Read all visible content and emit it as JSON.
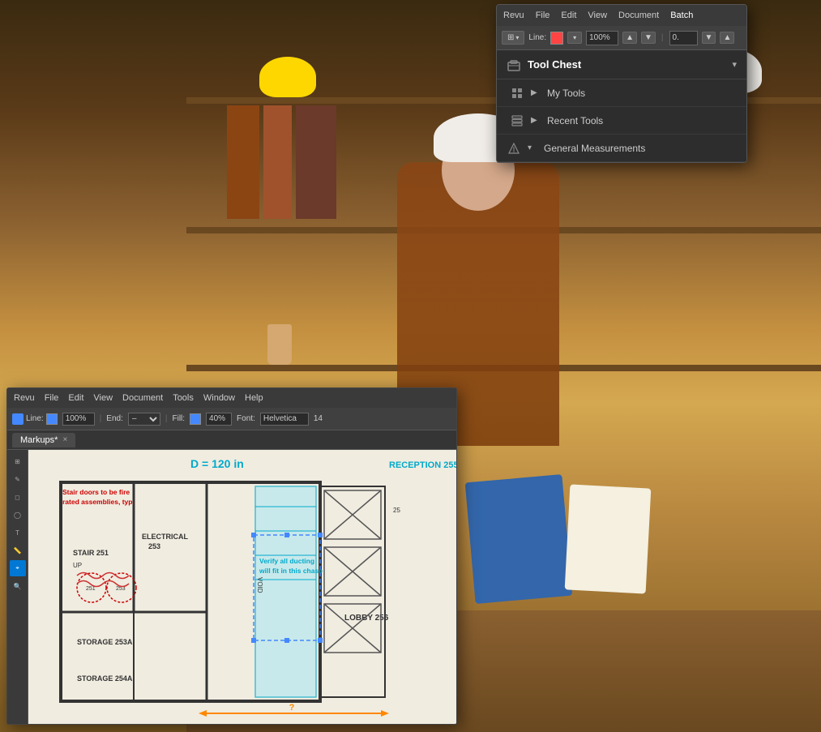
{
  "workshop": {
    "alt": "Worker in hard hat examining blueprints in a workshop"
  },
  "revu_bg": {
    "menubar": {
      "items": [
        "Revu",
        "File",
        "Edit",
        "View",
        "Document",
        "Tools",
        "Window",
        "Help"
      ]
    },
    "toolbar": {
      "line_label": "Line:",
      "zoom_value": "100%",
      "end_label": "End:",
      "fill_label": "Fill:",
      "fill_percent": "40%",
      "font_label": "Font:",
      "font_value": "Helvetica",
      "size_value": "14"
    },
    "tab": {
      "name": "Markups*",
      "close": "×"
    },
    "annotations": {
      "fire_rated": "Stair doors to be fire rated assemblies, typ.",
      "reception": "RECEPTION 255",
      "duct": "Verify all ducting will fit in this chase",
      "dimension_d": "D = 120 in",
      "question": "?"
    },
    "rooms": {
      "stair": "STAIR 251",
      "electrical": "ELECTRICAL 253",
      "storage_a": "STORAGE 253A",
      "storage_b": "STORAGE 254A",
      "lobby": "LOBBY 256",
      "void": "VOID"
    }
  },
  "revu_main": {
    "menubar": {
      "items": [
        "Revu",
        "File",
        "Edit",
        "View",
        "Document",
        "Batch"
      ]
    },
    "toolbar": {
      "line_label": "Line:",
      "zoom_value": "100%"
    },
    "tool_chest": {
      "title": "Tool Chest",
      "chevron": "▾",
      "items": [
        {
          "id": "my-tools",
          "label": "My Tools",
          "has_arrow": true,
          "expanded": false,
          "icon": "folder-icon"
        },
        {
          "id": "recent-tools",
          "label": "Recent Tools",
          "has_arrow": true,
          "expanded": false,
          "icon": "clock-icon"
        },
        {
          "id": "general-measurements",
          "label": "General Measurements",
          "has_arrow": false,
          "expanded": true,
          "icon": "measure-icon"
        }
      ]
    },
    "icons": {
      "tool_chest": "⊞",
      "my_tools": "📁",
      "recent_tools": "🕐",
      "measurements": "📐"
    }
  }
}
